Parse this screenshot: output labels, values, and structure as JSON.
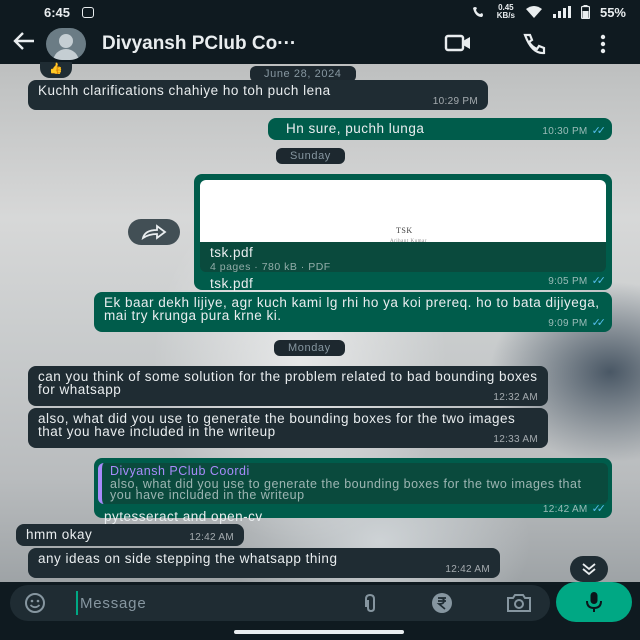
{
  "status_bar": {
    "time": "6:45",
    "speed_value": "0.45",
    "speed_unit": "KB/s",
    "battery": "55%"
  },
  "header": {
    "back_icon": "arrow-left-icon",
    "contact_name": "Divyansh PClub Co···"
  },
  "chat": {
    "reaction": "👍",
    "date_1": "June 28, 2024",
    "msg_1": {
      "text": "Kuchh clarifications chahiye ho toh puch lena",
      "time": "10:29 PM"
    },
    "msg_2": {
      "text": "Hn sure, puchh lunga",
      "time": "10:30 PM"
    },
    "date_2": "Sunday",
    "pdf": {
      "preview_title": "TSK",
      "preview_subtitle": "Arihant Kumar",
      "file_name": "tsk.pdf",
      "details": "4 pages · 780 kB · PDF",
      "caption": "tsk.pdf",
      "time": "9:05 PM"
    },
    "msg_3": {
      "text": "Ek baar dekh lijiye, agr kuch kami lg rhi ho ya koi prereq. ho to bata dijiyega, mai try krunga pura krne ki.",
      "time": "9:09 PM"
    },
    "date_3": "Monday",
    "msg_4": {
      "text": "can you think of some solution for the problem related to bad bounding boxes for whatsapp",
      "time": "12:32 AM"
    },
    "msg_5": {
      "text": "also, what did you use to generate the bounding boxes for the two images that you have included in the writeup",
      "time": "12:33 AM"
    },
    "msg_6": {
      "quote_author": "Divyansh PClub Coordi",
      "quote_text": "also, what did you use to generate the bounding boxes for the two images that you have included in the writeup",
      "text": "pytesseract and open-cv",
      "time": "12:42 AM"
    },
    "msg_7": {
      "text": "hmm okay",
      "time": "12:42 AM"
    },
    "msg_8": {
      "text": "any ideas on side stepping the whatsapp thing",
      "time": "12:42 AM"
    }
  },
  "input": {
    "placeholder": "Message"
  },
  "colors": {
    "incoming_bubble": "#1f2c33",
    "outgoing_bubble": "#005c4b",
    "accent": "#00a884",
    "read_ticks": "#53bdeb",
    "quote_author": "#a78bfa"
  }
}
